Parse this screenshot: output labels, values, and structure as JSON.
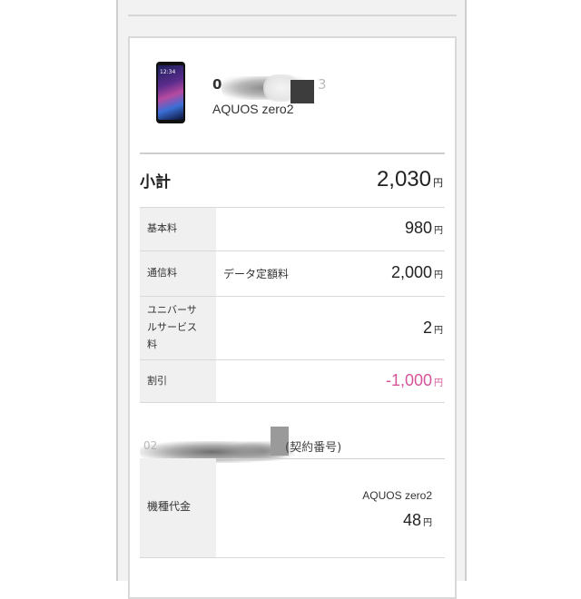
{
  "line": {
    "phone_number_visible": "0",
    "phone_number_tail": "3",
    "model": "AQUOS zero2",
    "device_clock": "12:34"
  },
  "subtotal": {
    "label": "小計",
    "value": "2,030",
    "unit": "円"
  },
  "breakdown": [
    {
      "label": "基本料",
      "detail": "",
      "value": "980",
      "unit": "円"
    },
    {
      "label": "通信料",
      "detail": "データ定額料",
      "value": "2,000",
      "unit": "円"
    },
    {
      "label_lines": [
        "ユニバーサ",
        "ルサービス",
        "料"
      ],
      "detail": "",
      "value": "2",
      "unit": "円"
    },
    {
      "label": "割引",
      "detail": "",
      "value": "-1,000",
      "unit": "円"
    }
  ],
  "contract": {
    "prefix": "02",
    "label": "(契約番号)"
  },
  "device_cost": {
    "label": "機種代金",
    "model": "AQUOS zero2",
    "value": "48",
    "unit": "円"
  },
  "colors": {
    "discount": "#d6559a",
    "label_bg": "#f0f0f0",
    "frame_bg": "#f2f2f2"
  }
}
